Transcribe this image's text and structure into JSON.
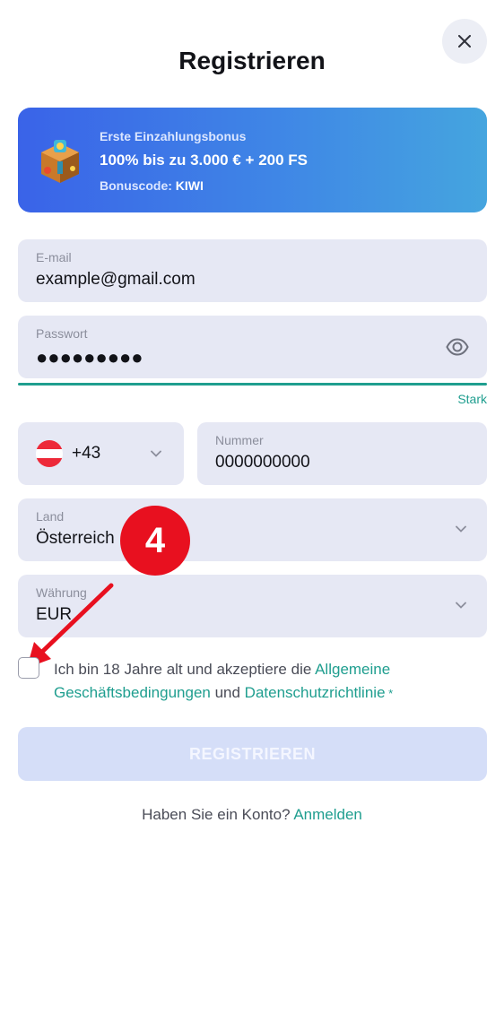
{
  "header": {
    "title": "Registrieren",
    "close_icon": "close-icon"
  },
  "bonus": {
    "icon": "treasure-chest-icon",
    "line1": "Erste Einzahlungsbonus",
    "line2": "100% bis zu 3.000 € + 200 FS",
    "code_label": "Bonuscode: ",
    "code_value": "KIWI"
  },
  "email": {
    "label": "E-mail",
    "value": "example@gmail.com"
  },
  "password": {
    "label": "Passwort",
    "value": "●●●●●●●●●",
    "eye_icon": "eye-icon",
    "strength": "Stark",
    "strength_color": "#1f9e8f"
  },
  "phone": {
    "flag": "austria-flag-icon",
    "code": "+43",
    "number_label": "Nummer",
    "number_value": "0000000000"
  },
  "country": {
    "label": "Land",
    "value": "Österreich"
  },
  "currency": {
    "label": "Währung",
    "value": "EUR"
  },
  "annotation": {
    "step": "4",
    "color": "#e8101f"
  },
  "terms": {
    "text1": "Ich bin 18 Jahre alt und akzeptiere die ",
    "link1": "Allgemeine Geschäftsbedingungen",
    "text2": " und ",
    "link2": "Datenschutzrichtlinie",
    "required": " *"
  },
  "submit": {
    "label": "REGISTRIEREN"
  },
  "login": {
    "text": "Haben Sie ein Konto? ",
    "link": "Anmelden"
  },
  "colors": {
    "accent": "#1f9e8f",
    "field_bg": "#e6e8f4",
    "button_disabled": "#d5def8"
  }
}
